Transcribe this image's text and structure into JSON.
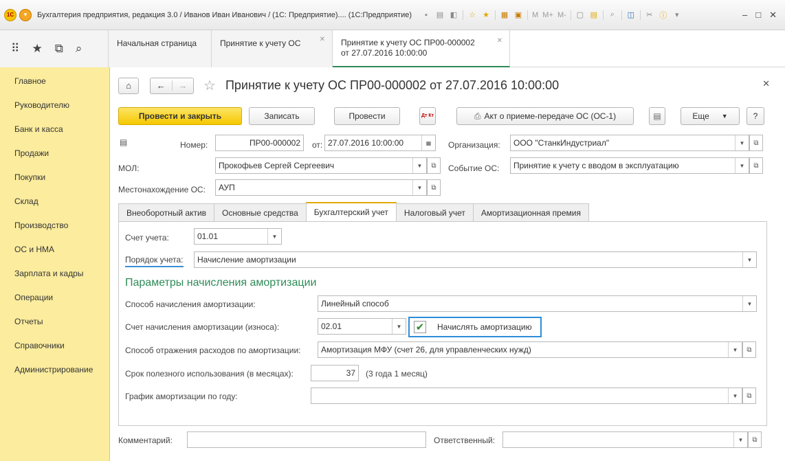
{
  "window": {
    "title": "Бухгалтерия предприятия, редакция 3.0 / Иванов Иван Иванович / (1С: Предприятие).... (1С:Предприятие)",
    "toolbar_text": "M  M+  M-"
  },
  "tabs": [
    {
      "label": "Начальная страница"
    },
    {
      "label": "Принятие к учету ОС"
    },
    {
      "label_line1": "Принятие к учету ОС ПР00-000002",
      "label_line2": "от 27.07.2016 10:00:00"
    }
  ],
  "sidebar": {
    "items": [
      "Главное",
      "Руководителю",
      "Банк и касса",
      "Продажи",
      "Покупки",
      "Склад",
      "Производство",
      "ОС и НМА",
      "Зарплата и кадры",
      "Операции",
      "Отчеты",
      "Справочники",
      "Администрирование"
    ]
  },
  "doc": {
    "title": "Принятие к учету ОС ПР00-000002 от 27.07.2016 10:00:00"
  },
  "commands": {
    "post_close": "Провести и закрыть",
    "save": "Записать",
    "post": "Провести",
    "dt_kt": "Дт Кт",
    "act": "Акт о приеме-передаче ОС (ОС-1)",
    "more": "Еще",
    "help": "?"
  },
  "header": {
    "number_label": "Номер:",
    "number_value": "ПР00-000002",
    "date_label": "от:",
    "date_value": "27.07.2016 10:00:00",
    "org_label": "Организация:",
    "org_value": "ООО \"СтанкИндустриал\"",
    "mol_label": "МОЛ:",
    "mol_value": "Прокофьев Сергей Сергеевич",
    "event_label": "Событие ОС:",
    "event_value": "Принятие к учету с вводом в эксплуатацию",
    "location_label": "Местонахождение ОС:",
    "location_value": "АУП"
  },
  "form_tabs": [
    "Внеоборотный актив",
    "Основные средства",
    "Бухгалтерский учет",
    "Налоговый учет",
    "Амортизационная премия"
  ],
  "accounting": {
    "account_label": "Счет учета:",
    "account_value": "01.01",
    "order_label": "Порядок учета:",
    "order_value": "Начисление амортизации",
    "section_title": "Параметры начисления амортизации",
    "method_label": "Способ начисления амортизации:",
    "method_value": "Линейный способ",
    "dep_account_label": "Счет начисления амортизации (износа):",
    "dep_account_value": "02.01",
    "accrue_label": "Начислять амортизацию",
    "accrue_checked": true,
    "expense_label": "Способ отражения расходов по амортизации:",
    "expense_value": "Амортизация МФУ (счет 26, для управленческих нужд)",
    "life_label": "Срок полезного использования (в месяцах):",
    "life_value": "37",
    "life_text": "(3 года 1 месяц)",
    "schedule_label": "График амортизации по году:",
    "schedule_value": ""
  },
  "footer": {
    "comment_label": "Комментарий:",
    "comment_value": "",
    "responsible_label": "Ответственный:",
    "responsible_value": ""
  }
}
